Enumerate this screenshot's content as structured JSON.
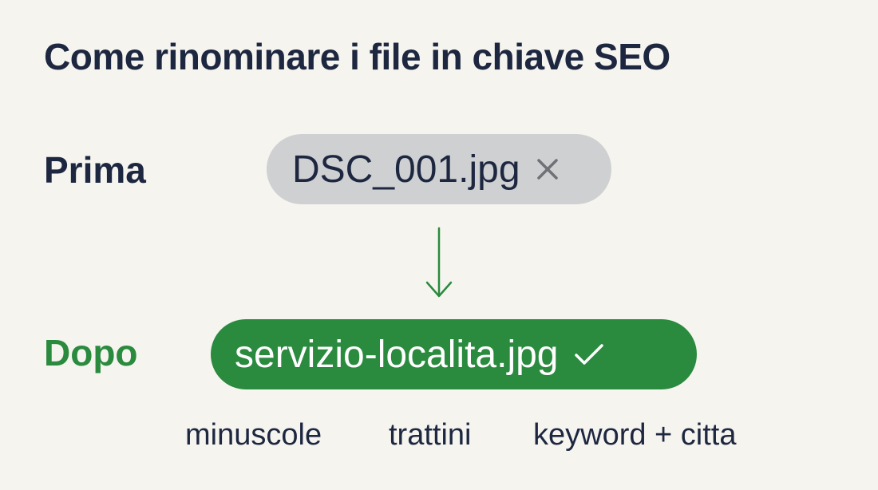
{
  "title": "Come rinominare i file in chiave SEO",
  "before": {
    "label": "Prima",
    "filename": "DSC_001.jpg",
    "icon": "x-mark-icon"
  },
  "after": {
    "label": "Dopo",
    "filename": "servizio-localita.jpg",
    "icon": "check-mark-icon"
  },
  "arrow_icon": "arrow-down-icon",
  "hints": [
    "minuscole",
    "trattini",
    "keyword + citta"
  ],
  "colors": {
    "background": "#f6f4ef",
    "text": "#1d2740",
    "accent_green": "#2a8a3e",
    "pill_gray": "#cfd0d2",
    "icon_gray": "#6e7175"
  }
}
